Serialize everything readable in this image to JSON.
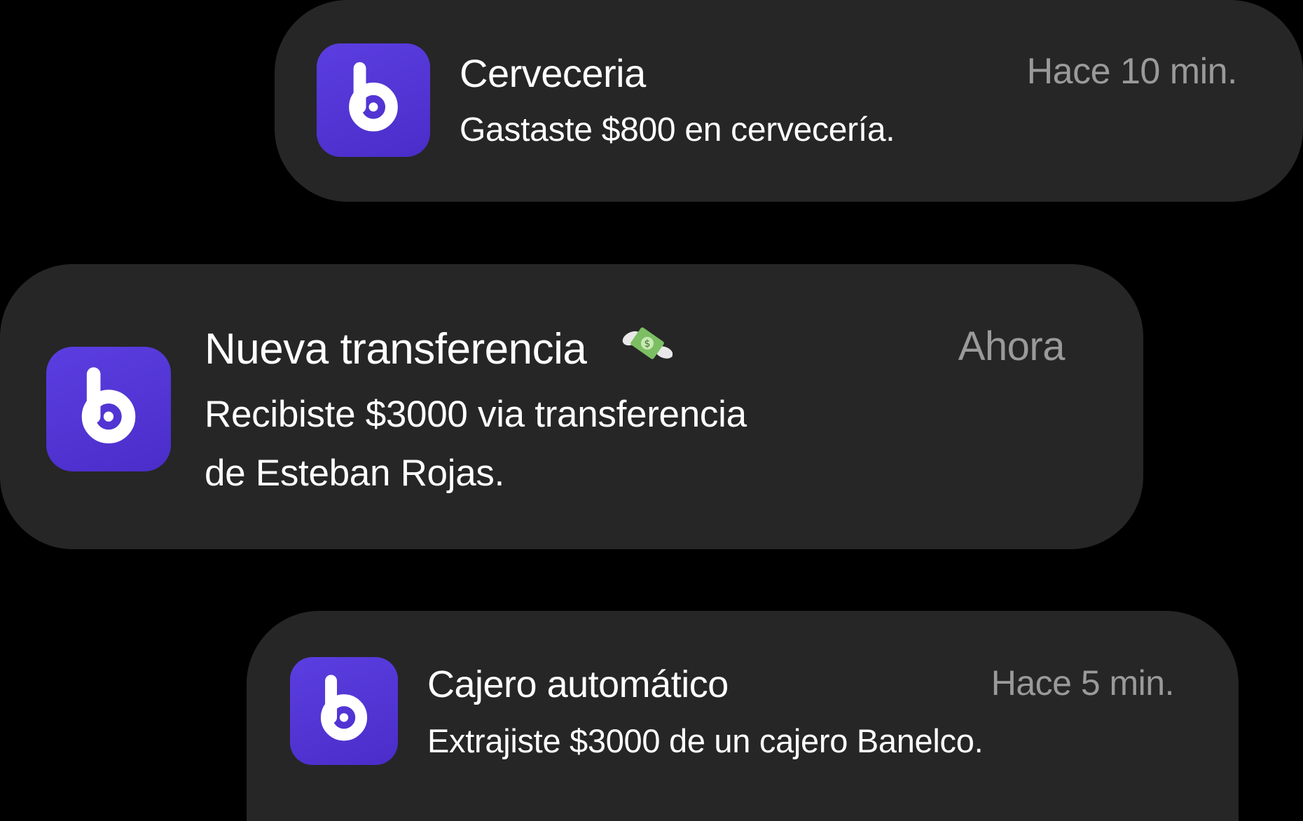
{
  "colors": {
    "background": "#000000",
    "card": "#262626",
    "icon_accent": "#5b3ee0",
    "title_text": "#ffffff",
    "time_text": "#9a9a9a"
  },
  "notifications": [
    {
      "app_icon": "app-b-logo-icon",
      "title": "Cerveceria",
      "body": "Gastaste $800 en cervecería.",
      "time": "Hace 10 min."
    },
    {
      "app_icon": "app-b-logo-icon",
      "title": "Nueva transferencia",
      "title_emoji": "money-with-wings-icon",
      "body_line1": "Recibiste $3000 via transferencia",
      "body_line2": "de Esteban Rojas.",
      "time": "Ahora"
    },
    {
      "app_icon": "app-b-logo-icon",
      "title": "Cajero automático",
      "body": "Extrajiste $3000 de un cajero Banelco.",
      "time": "Hace 5 min."
    }
  ]
}
